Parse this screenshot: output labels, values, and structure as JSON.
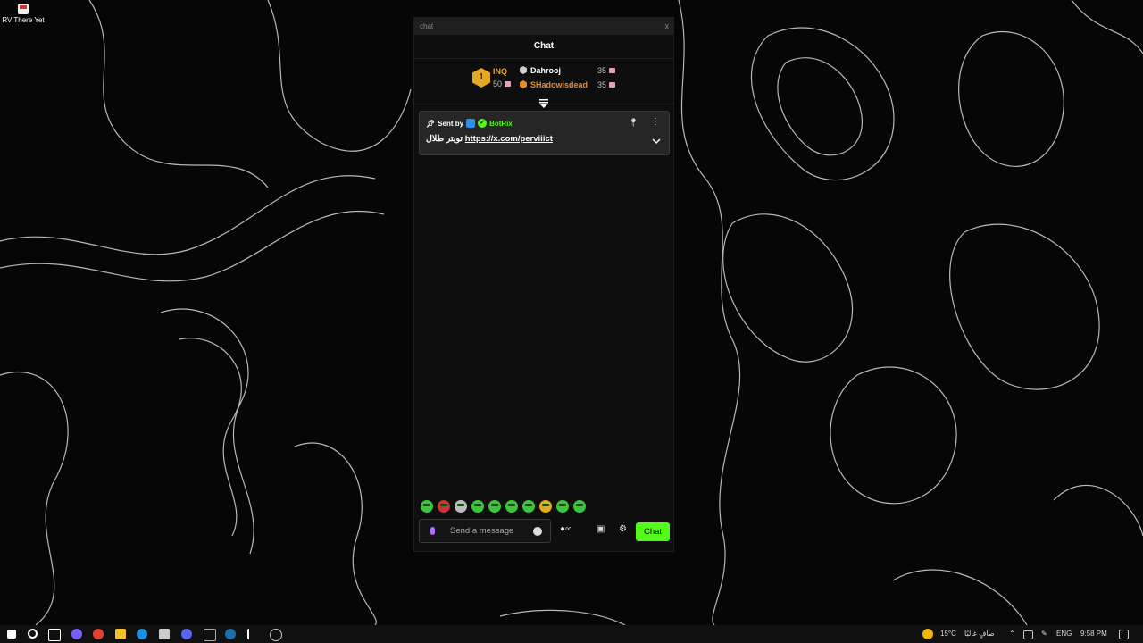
{
  "desktop": {
    "icon_label": "RV There Yet"
  },
  "window": {
    "title": "chat",
    "close": "x"
  },
  "chat": {
    "header": "Chat",
    "leaderboard": {
      "first": {
        "rank": "1",
        "name": "INQ",
        "points": "50"
      },
      "rows": [
        {
          "name": "Dahrooj",
          "points": "35",
          "color": "#ffffff",
          "hex_color": "#d0d0d0"
        },
        {
          "name": "SHadowisdead",
          "points": "35",
          "color": "#e88a2e",
          "hex_color": "#e88a2e"
        }
      ]
    },
    "pinned": {
      "sent_by": "Sent by",
      "bot_name": "BotRix",
      "message_text": "تويتر طلال",
      "message_link": "https://x.com/perviiict"
    },
    "input": {
      "placeholder": "Send a message"
    },
    "send_button": "Chat"
  },
  "taskbar": {
    "weather": "15°C",
    "weather_desc": "صافٍ غالبًا",
    "language": "ENG",
    "time": "9:58 PM"
  },
  "colors": {
    "accent": "#53fc18",
    "gold": "#e6a820",
    "bot_badge": "#2d8fe6"
  }
}
